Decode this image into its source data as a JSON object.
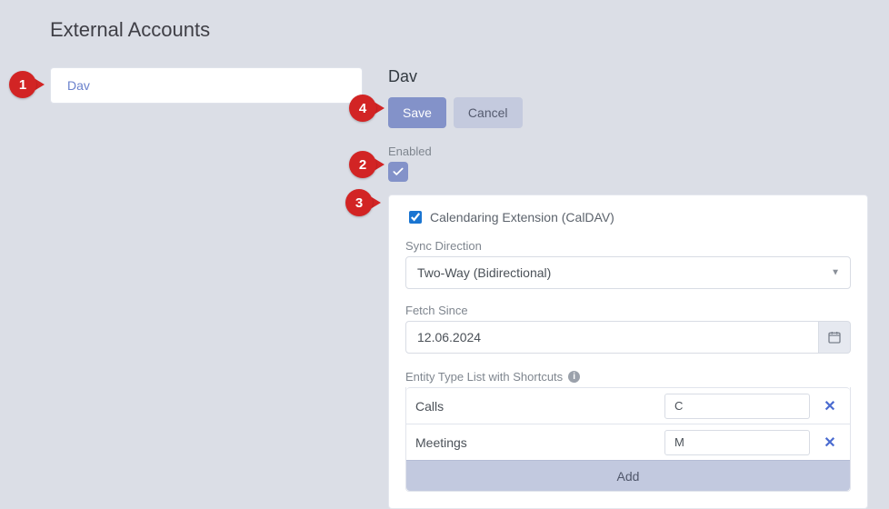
{
  "page_title": "External Accounts",
  "sidebar": {
    "items": [
      {
        "label": "Dav"
      }
    ]
  },
  "detail": {
    "heading": "Dav",
    "save_label": "Save",
    "cancel_label": "Cancel",
    "enabled_label": "Enabled",
    "enabled_checked": true
  },
  "extension": {
    "title": "Calendaring Extension (CalDAV)",
    "checked": true,
    "sync_direction": {
      "label": "Sync Direction",
      "value": "Two-Way (Bidirectional)"
    },
    "fetch_since": {
      "label": "Fetch Since",
      "value": "12.06.2024"
    },
    "entity_list": {
      "label": "Entity Type List with Shortcuts",
      "rows": [
        {
          "name": "Calls",
          "shortcut": "C"
        },
        {
          "name": "Meetings",
          "shortcut": "M"
        }
      ],
      "add_label": "Add"
    }
  },
  "callouts": {
    "c1": "1",
    "c2": "2",
    "c3": "3",
    "c4": "4"
  }
}
